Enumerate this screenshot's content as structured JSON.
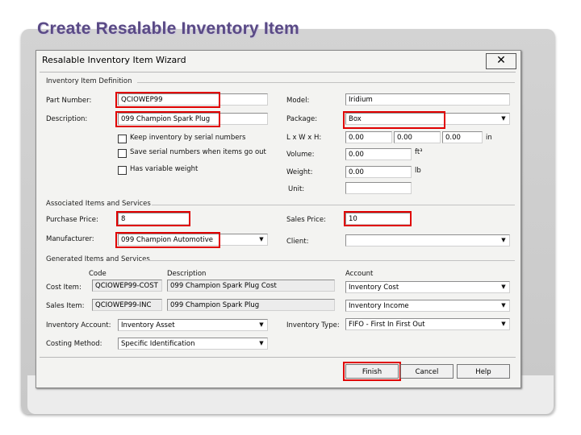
{
  "slide": {
    "title": "Create Resalable Inventory Item"
  },
  "dialog": {
    "title": "Resalable Inventory Item Wizard",
    "close_icon": "close-icon",
    "sections": {
      "definition": "Inventory Item Definition",
      "associated": "Associated Items and Services",
      "generated": "Generated Items and Services"
    },
    "definition": {
      "part_number_label": "Part Number:",
      "part_number": "QCIOWEP99",
      "description_label": "Description:",
      "description": "099 Champion Spark Plug",
      "keep_serial_label": "Keep inventory by serial numbers",
      "keep_serial_checked": false,
      "save_serial_label": "Save serial numbers when items go out",
      "save_serial_checked": false,
      "variable_weight_label": "Has variable weight",
      "variable_weight_checked": false,
      "model_label": "Model:",
      "model": "Iridium",
      "package_label": "Package:",
      "package": "Box",
      "lwh_label": "L x W x H:",
      "length": "0.00",
      "width": "0.00",
      "height": "0.00",
      "lwh_unit": "in",
      "volume_label": "Volume:",
      "volume": "0.00",
      "volume_unit": "ft³",
      "weight_label": "Weight:",
      "weight": "0.00",
      "weight_unit": "lb",
      "unit_label": "Unit:",
      "unit": ""
    },
    "associated": {
      "purchase_price_label": "Purchase Price:",
      "purchase_price": "8",
      "sales_price_label": "Sales Price:",
      "sales_price": "10",
      "manufacturer_label": "Manufacturer:",
      "manufacturer": "099 Champion Automotive",
      "client_label": "Client:",
      "client": ""
    },
    "generated": {
      "col_code": "Code",
      "col_description": "Description",
      "col_account": "Account",
      "cost_item_label": "Cost Item:",
      "cost_item_code": "QCIOWEP99-COST",
      "cost_item_desc": "099 Champion Spark Plug Cost",
      "cost_item_account": "Inventory Cost",
      "sales_item_label": "Sales Item:",
      "sales_item_code": "QCIOWEP99-INC",
      "sales_item_desc": "099 Champion Spark Plug",
      "sales_item_account": "Inventory Income",
      "inventory_account_label": "Inventory Account:",
      "inventory_account": "Inventory Asset",
      "inventory_type_label": "Inventory Type:",
      "inventory_type": "FIFO - First In First Out",
      "costing_method_label": "Costing Method:",
      "costing_method": "Specific Identification"
    },
    "buttons": {
      "finish": "Finish",
      "cancel": "Cancel",
      "help": "Help"
    }
  },
  "colors": {
    "highlight": "#e00000",
    "title": "#5a4a86"
  }
}
